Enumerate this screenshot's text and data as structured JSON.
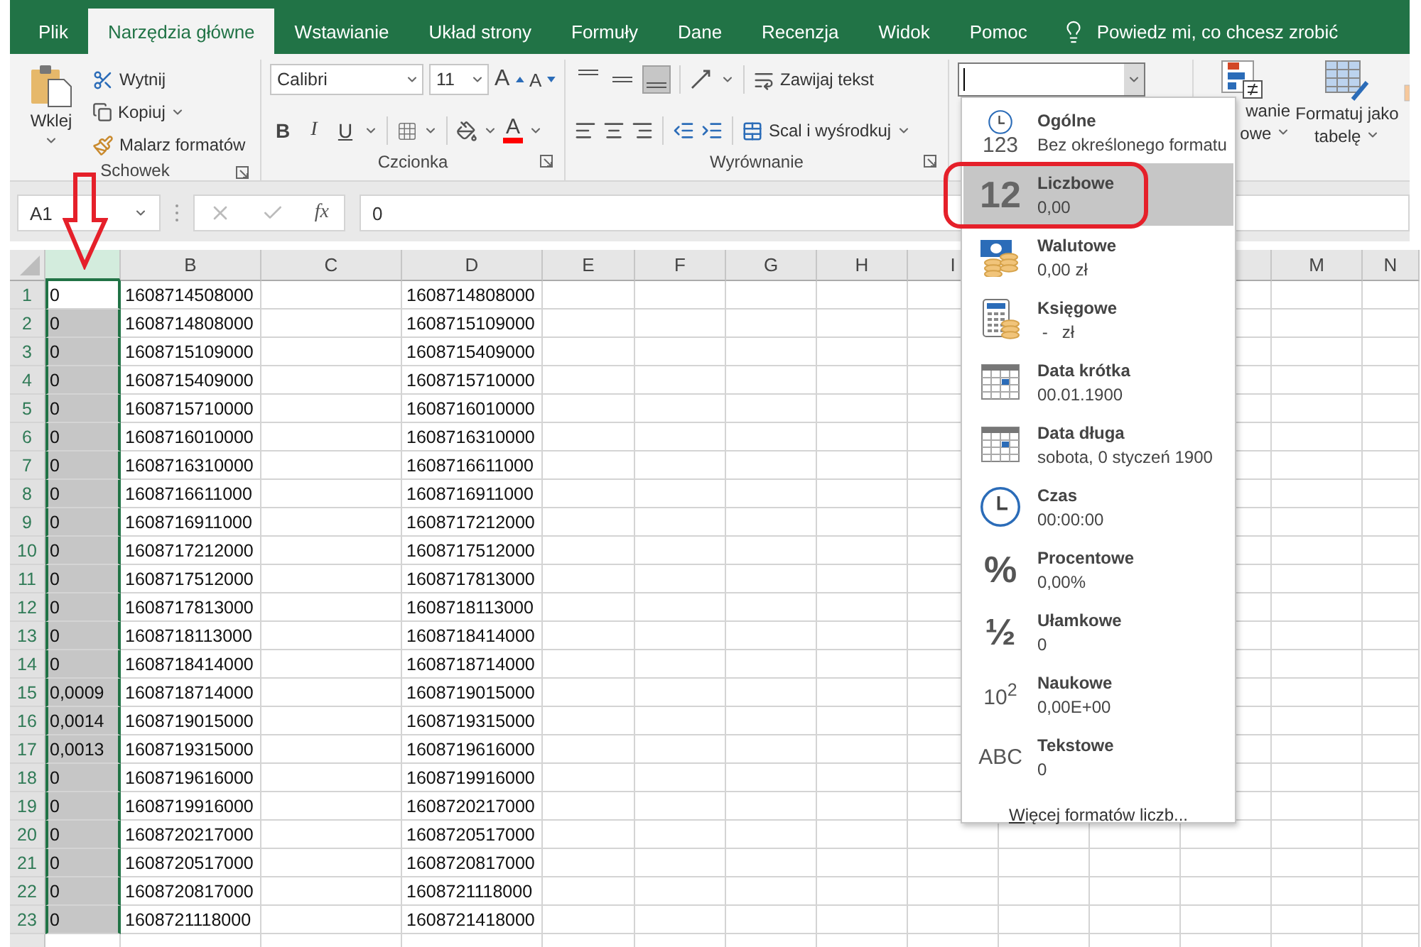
{
  "tabs": [
    {
      "label": "Plik",
      "selected": false
    },
    {
      "label": "Narzędzia główne",
      "selected": true
    },
    {
      "label": "Wstawianie",
      "selected": false
    },
    {
      "label": "Układ strony",
      "selected": false
    },
    {
      "label": "Formuły",
      "selected": false
    },
    {
      "label": "Dane",
      "selected": false
    },
    {
      "label": "Recenzja",
      "selected": false
    },
    {
      "label": "Widok",
      "selected": false
    },
    {
      "label": "Pomoc",
      "selected": false
    }
  ],
  "tell_me": "Powiedz mi, co chcesz zrobić",
  "clipboard": {
    "paste": "Wklej",
    "cut": "Wytnij",
    "copy": "Kopiuj",
    "format_painter": "Malarz formatów",
    "label": "Schowek"
  },
  "font": {
    "name": "Calibri",
    "size": "11",
    "grow": "A",
    "shrink": "A",
    "bold": "B",
    "italic": "I",
    "underline": "U",
    "font_color": "A",
    "label": "Czcionka"
  },
  "alignment": {
    "vertical": [
      {
        "kind": "top",
        "selected": false
      },
      {
        "kind": "middle",
        "selected": false
      },
      {
        "kind": "bottom",
        "selected": true
      }
    ],
    "wrap": "Zawijaj tekst",
    "merge": "Scal i wyśrodkuj",
    "label": "Wyrównanie"
  },
  "styles": {
    "conditional": [
      "wanie",
      "owe"
    ],
    "table": [
      "Formatuj jako",
      "tabelę"
    ]
  },
  "formula_bar": {
    "name_box": "A1",
    "function_symbol": "fx",
    "formula": "0"
  },
  "columns": [
    {
      "selected": true
    },
    {
      "label": "B",
      "selected": false
    },
    {
      "label": "C",
      "selected": false
    },
    {
      "label": "D",
      "selected": false
    },
    {
      "label": "E",
      "selected": false
    },
    {
      "label": "F",
      "selected": false
    },
    {
      "label": "G",
      "selected": false
    },
    {
      "label": "H",
      "selected": false
    },
    {
      "label": "I",
      "selected": false
    },
    {
      "label": "M",
      "selected": false
    },
    {
      "label": "N",
      "selected": false
    }
  ],
  "rows": [
    {
      "number": "1",
      "active": true,
      "a": "0",
      "b": "1608714508000",
      "d": "1608714808000"
    },
    {
      "number": "2",
      "active": false,
      "a": "0",
      "b": "1608714808000",
      "d": "1608715109000"
    },
    {
      "number": "3",
      "active": false,
      "a": "0",
      "b": "1608715109000",
      "d": "1608715409000"
    },
    {
      "number": "4",
      "active": false,
      "a": "0",
      "b": "1608715409000",
      "d": "1608715710000"
    },
    {
      "number": "5",
      "active": false,
      "a": "0",
      "b": "1608715710000",
      "d": "1608716010000"
    },
    {
      "number": "6",
      "active": false,
      "a": "0",
      "b": "1608716010000",
      "d": "1608716310000"
    },
    {
      "number": "7",
      "active": false,
      "a": "0",
      "b": "1608716310000",
      "d": "1608716611000"
    },
    {
      "number": "8",
      "active": false,
      "a": "0",
      "b": "1608716611000",
      "d": "1608716911000"
    },
    {
      "number": "9",
      "active": false,
      "a": "0",
      "b": "1608716911000",
      "d": "1608717212000"
    },
    {
      "number": "10",
      "active": false,
      "a": "0",
      "b": "1608717212000",
      "d": "1608717512000"
    },
    {
      "number": "11",
      "active": false,
      "a": "0",
      "b": "1608717512000",
      "d": "1608717813000"
    },
    {
      "number": "12",
      "active": false,
      "a": "0",
      "b": "1608717813000",
      "d": "1608718113000"
    },
    {
      "number": "13",
      "active": false,
      "a": "0",
      "b": "1608718113000",
      "d": "1608718414000"
    },
    {
      "number": "14",
      "active": false,
      "a": "0",
      "b": "1608718414000",
      "d": "1608718714000"
    },
    {
      "number": "15",
      "active": false,
      "a": "0,0009",
      "b": "1608718714000",
      "d": "1608719015000"
    },
    {
      "number": "16",
      "active": false,
      "a": "0,0014",
      "b": "1608719015000",
      "d": "1608719315000"
    },
    {
      "number": "17",
      "active": false,
      "a": "0,0013",
      "b": "1608719315000",
      "d": "1608719616000"
    },
    {
      "number": "18",
      "active": false,
      "a": "0",
      "b": "1608719616000",
      "d": "1608719916000"
    },
    {
      "number": "19",
      "active": false,
      "a": "0",
      "b": "1608719916000",
      "d": "1608720217000"
    },
    {
      "number": "20",
      "active": false,
      "a": "0",
      "b": "1608720217000",
      "d": "1608720517000"
    },
    {
      "number": "21",
      "active": false,
      "a": "0",
      "b": "1608720517000",
      "d": "1608720817000"
    },
    {
      "number": "22",
      "active": false,
      "a": "0",
      "b": "1608720817000",
      "d": "1608721118000"
    },
    {
      "number": "23",
      "active": false,
      "a": "0",
      "b": "1608721118000",
      "d": "1608721418000"
    }
  ],
  "format_menu": {
    "items": [
      {
        "kind": "general",
        "glyph": "123",
        "name": "Ogólne",
        "sample": "Bez określonego formatu",
        "selected": false
      },
      {
        "kind": "number",
        "glyph": "12",
        "name": "Liczbowe",
        "sample": "0,00",
        "selected": true
      },
      {
        "kind": "currency",
        "name": "Walutowe",
        "sample": "0,00 zł",
        "selected": false
      },
      {
        "kind": "accounting",
        "name": "Księgowe",
        "sample": " -   zł",
        "selected": false
      },
      {
        "kind": "short_date",
        "name": "Data krótka",
        "sample": "00.01.1900",
        "selected": false
      },
      {
        "kind": "long_date",
        "name": "Data długa",
        "sample": "sobota, 0 styczeń 1900",
        "selected": false
      },
      {
        "kind": "time",
        "name": "Czas",
        "sample": "00:00:00",
        "selected": false
      },
      {
        "kind": "percent",
        "glyph": "%",
        "name": "Procentowe",
        "sample": "0,00%",
        "selected": false
      },
      {
        "kind": "fraction",
        "glyph": "½",
        "name": "Ułamkowe",
        "sample": "0",
        "selected": false
      },
      {
        "kind": "scientific",
        "glyph": "10$^{2}$",
        "name": "Naukowe",
        "sample": "0,00E+00",
        "selected": false
      },
      {
        "kind": "text",
        "glyph": "ABC",
        "name": "Tekstowe",
        "sample": "0",
        "selected": false
      }
    ],
    "more": "Więcej formatów liczb..."
  }
}
